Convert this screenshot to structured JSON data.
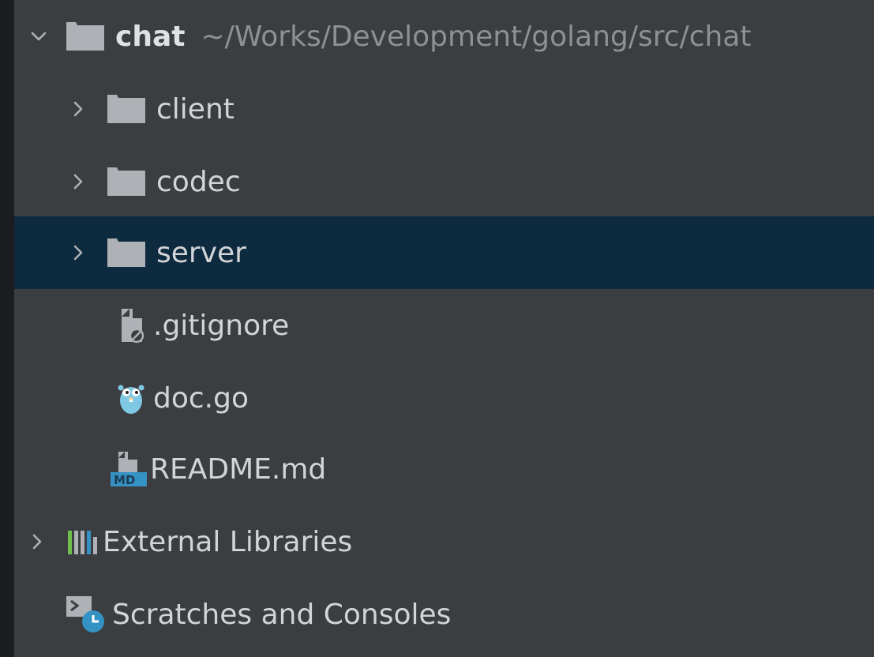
{
  "project_tree": {
    "root": {
      "name": "chat",
      "path": "~/Works/Development/golang/src/chat"
    },
    "folders": [
      {
        "label": "client"
      },
      {
        "label": "codec"
      },
      {
        "label": "server"
      }
    ],
    "files": [
      {
        "label": ".gitignore",
        "icon": "gitignore-file-icon"
      },
      {
        "label": "doc.go",
        "icon": "go-gopher-icon"
      },
      {
        "label": "README.md",
        "icon": "markdown-file-icon"
      }
    ],
    "external_libraries": {
      "label": "External Libraries",
      "icon": "library-icon"
    },
    "scratches": {
      "label": "Scratches and Consoles",
      "icon": "scratches-icon"
    }
  },
  "colors": {
    "panel_bg": "#3b3d40",
    "selected_bg": "#0d2a3f",
    "text": "#d2d4d7",
    "path_text": "#8d9094",
    "folder": "#aeb1b5",
    "accent_blue": "#3592c4"
  }
}
